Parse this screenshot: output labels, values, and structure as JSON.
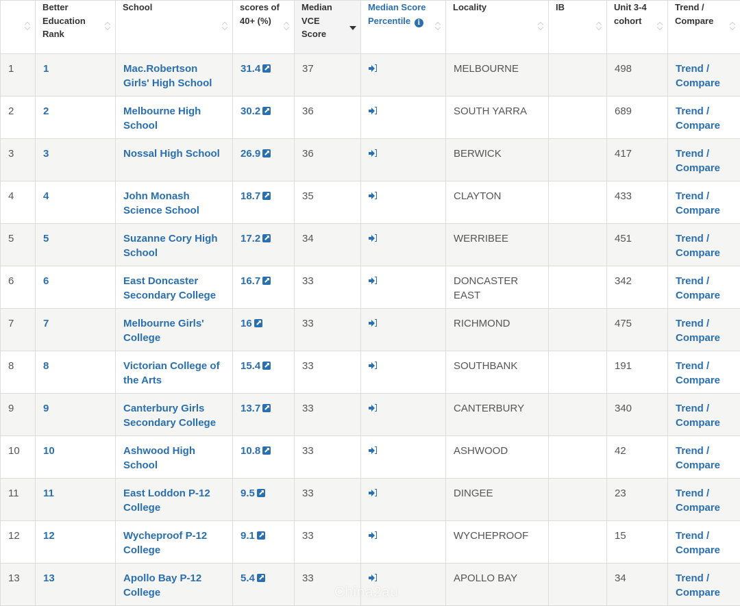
{
  "headers": {
    "index": "",
    "rank": "Better Education Rank",
    "school": "School",
    "scores40": "scores of 40+ (%)",
    "median_vce": "Median VCE Score",
    "median_pct": "Median Score Percentile",
    "locality": "Locality",
    "ib": "IB",
    "cohort": "Unit 3-4 cohort",
    "trend": "Trend / Compare"
  },
  "icons": {
    "sort": "sort-both-icon",
    "sorted_desc": "sort-desc-icon",
    "info": "info-circle-icon",
    "external": "external-link-icon",
    "percentile": "sign-in-icon"
  },
  "colors": {
    "link": "#2a6fb0",
    "row_alt": "#f5f5f3",
    "border": "#dddddd"
  },
  "rows": [
    {
      "index": "1",
      "rank": "1",
      "school": "Mac.Robertson Girls' High School",
      "scores40": "31.4",
      "median": "37",
      "locality": "MELBOURNE",
      "ib": "",
      "cohort": "498",
      "trend": "Trend / Compare"
    },
    {
      "index": "2",
      "rank": "2",
      "school": "Melbourne High School",
      "scores40": "30.2",
      "median": "36",
      "locality": "SOUTH YARRA",
      "ib": "",
      "cohort": "689",
      "trend": "Trend / Compare"
    },
    {
      "index": "3",
      "rank": "3",
      "school": "Nossal High School",
      "scores40": "26.9",
      "median": "36",
      "locality": "BERWICK",
      "ib": "",
      "cohort": "417",
      "trend": "Trend / Compare"
    },
    {
      "index": "4",
      "rank": "4",
      "school": "John Monash Science School",
      "scores40": "18.7",
      "median": "35",
      "locality": "CLAYTON",
      "ib": "",
      "cohort": "433",
      "trend": "Trend / Compare"
    },
    {
      "index": "5",
      "rank": "5",
      "school": "Suzanne Cory High School",
      "scores40": "17.2",
      "median": "34",
      "locality": "WERRIBEE",
      "ib": "",
      "cohort": "451",
      "trend": "Trend / Compare"
    },
    {
      "index": "6",
      "rank": "6",
      "school": "East Doncaster Secondary College",
      "scores40": "16.7",
      "median": "33",
      "locality": "DONCASTER EAST",
      "ib": "",
      "cohort": "342",
      "trend": "Trend / Compare"
    },
    {
      "index": "7",
      "rank": "7",
      "school": "Melbourne Girls' College",
      "scores40": "16",
      "median": "33",
      "locality": "RICHMOND",
      "ib": "",
      "cohort": "475",
      "trend": "Trend / Compare"
    },
    {
      "index": "8",
      "rank": "8",
      "school": "Victorian College of the Arts",
      "scores40": "15.4",
      "median": "33",
      "locality": "SOUTHBANK",
      "ib": "",
      "cohort": "191",
      "trend": "Trend / Compare"
    },
    {
      "index": "9",
      "rank": "9",
      "school": "Canterbury Girls Secondary College",
      "scores40": "13.7",
      "median": "33",
      "locality": "CANTERBURY",
      "ib": "",
      "cohort": "340",
      "trend": "Trend / Compare"
    },
    {
      "index": "10",
      "rank": "10",
      "school": "Ashwood High School",
      "scores40": "10.8",
      "median": "33",
      "locality": "ASHWOOD",
      "ib": "",
      "cohort": "42",
      "trend": "Trend / Compare"
    },
    {
      "index": "11",
      "rank": "11",
      "school": "East Loddon P-12 College",
      "scores40": "9.5",
      "median": "33",
      "locality": "DINGEE",
      "ib": "",
      "cohort": "23",
      "trend": "Trend / Compare"
    },
    {
      "index": "12",
      "rank": "12",
      "school": "Wycheproof P-12 College",
      "scores40": "9.1",
      "median": "33",
      "locality": "WYCHEPROOF",
      "ib": "",
      "cohort": "15",
      "trend": "Trend / Compare"
    },
    {
      "index": "13",
      "rank": "13",
      "school": "Apollo Bay P-12 College",
      "scores40": "5.4",
      "median": "33",
      "locality": "APOLLO BAY",
      "ib": "",
      "cohort": "34",
      "trend": "Trend / Compare"
    }
  ],
  "watermark": "Chinа2au"
}
